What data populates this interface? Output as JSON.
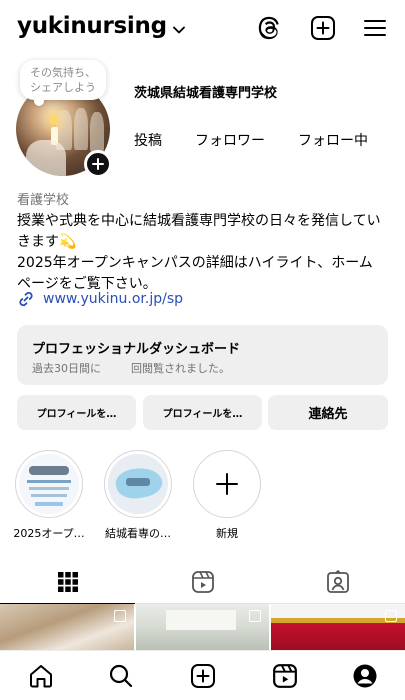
{
  "header": {
    "username": "yukinursing",
    "icons": [
      "chevron-down-icon",
      "threads-icon",
      "create-plus-icon",
      "menu-icon"
    ]
  },
  "note": {
    "line1": "その気持ち、",
    "line2": "シェアしよう"
  },
  "profile": {
    "display_name": "茨城県結城看護専門学校",
    "stats": [
      {
        "label": "投稿"
      },
      {
        "label": "フォロワー"
      },
      {
        "label": "フォロー中"
      }
    ]
  },
  "bio": {
    "category": "看護学校",
    "line1": "授業や式典を中心に結城看護専門学校の日々を発信してい",
    "line2": "きます💫",
    "line3": "2025年オープンキャンパスの詳細はハイライト、ホーム",
    "line4": "ページをご覧下さい。",
    "link": "www.yukinu.or.jp/sp"
  },
  "dashboard": {
    "title": "プロフェッショナルダッシュボード",
    "subtitle_before": "過去30日間に",
    "subtitle_after": "回閲覧されました。"
  },
  "buttons": {
    "edit_profile": "プロフィールを…",
    "share_profile": "プロフィールを…",
    "contact": "連絡先"
  },
  "highlights": [
    {
      "label": "2025オープ…"
    },
    {
      "label": "結城看専の…"
    },
    {
      "label": "新規"
    }
  ],
  "tabs": [
    "grid-icon",
    "reels-icon",
    "tagged-icon"
  ],
  "nav": [
    "home-icon",
    "search-icon",
    "create-icon",
    "reels-icon",
    "profile-icon"
  ],
  "colors": {
    "link": "#2a4fb5",
    "button_bg": "#efefef",
    "muted": "#737373"
  }
}
